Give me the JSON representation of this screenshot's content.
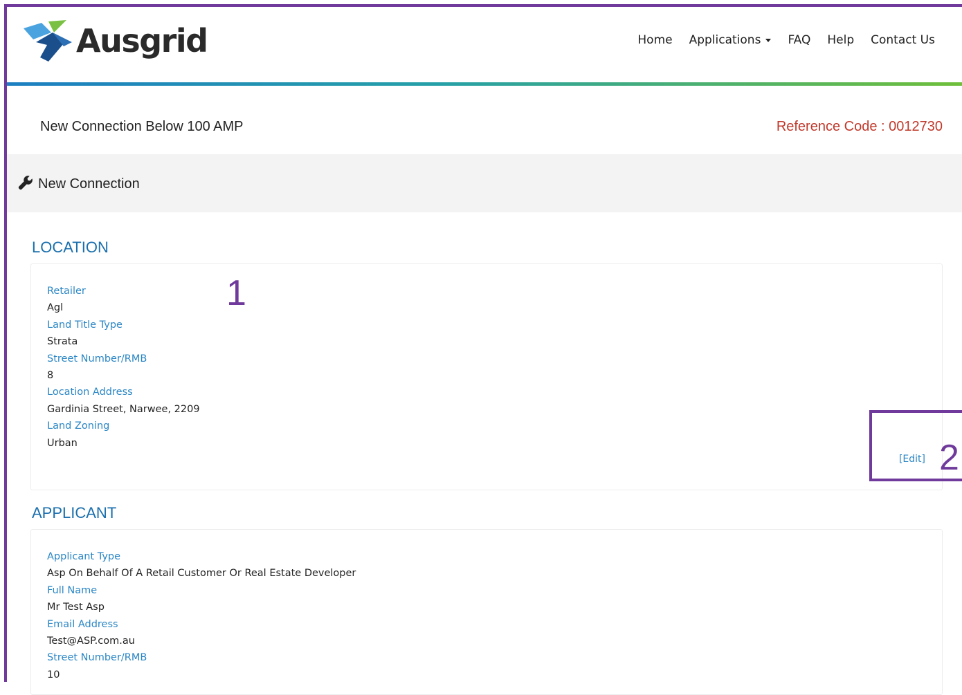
{
  "header": {
    "logo_text": "Ausgrid",
    "nav": [
      {
        "label": "Home"
      },
      {
        "label": "Applications"
      },
      {
        "label": "FAQ"
      },
      {
        "label": "Help"
      },
      {
        "label": "Contact Us"
      }
    ]
  },
  "page": {
    "title": "New Connection Below 100 AMP",
    "reference_code": "Reference Code : 0012730"
  },
  "section": {
    "icon": "wrench-icon",
    "title": "New Connection"
  },
  "location": {
    "title": "LOCATION",
    "fields": [
      {
        "label": "Retailer",
        "value": "Agl"
      },
      {
        "label": "Land Title Type",
        "value": "Strata"
      },
      {
        "label": "Street Number/RMB",
        "value": "8"
      },
      {
        "label": "Location Address",
        "value": "Gardinia Street, Narwee, 2209"
      },
      {
        "label": "Land Zoning",
        "value": "Urban"
      }
    ],
    "edit_label": "[Edit]"
  },
  "applicant": {
    "title": "APPLICANT",
    "fields": [
      {
        "label": "Applicant Type",
        "value": "Asp On Behalf Of A Retail Customer Or Real Estate Developer"
      },
      {
        "label": "Full Name",
        "value": "Mr Test Asp"
      },
      {
        "label": "Email Address",
        "value": "Test@ASP.com.au"
      },
      {
        "label": "Street Number/RMB",
        "value": "10"
      }
    ]
  },
  "annotations": {
    "marker_1": "1",
    "marker_2": "2"
  },
  "colors": {
    "accent_blue": "#1a6fad",
    "label_blue": "#2a86c5",
    "reference_red": "#c0392b",
    "annotation_purple": "#6f3a9b"
  }
}
